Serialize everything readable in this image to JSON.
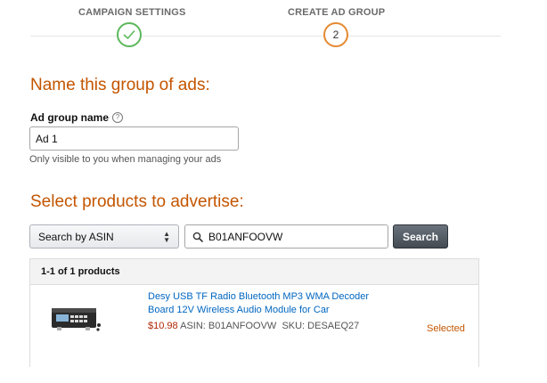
{
  "stepper": {
    "steps": [
      {
        "label": "CAMPAIGN SETTINGS",
        "state": "completed"
      },
      {
        "label": "CREATE AD GROUP",
        "number": "2",
        "state": "current"
      }
    ],
    "colors": {
      "completed": "#5cb85c",
      "current": "#e48a32"
    }
  },
  "ad_group": {
    "heading": "Name this group of ads:",
    "field_label": "Ad group name",
    "help_icon": "question-circle-icon",
    "value": "Ad 1",
    "hint": "Only visible to you when managing your ads"
  },
  "products": {
    "heading": "Select products to advertise:",
    "search_type": {
      "selected": "Search by ASIN"
    },
    "search": {
      "value": "B01ANFOOVW",
      "button_label": "Search",
      "icon": "search-icon"
    },
    "results": {
      "count_label": "1-1 of 1 products",
      "items": [
        {
          "title": "Desy USB TF Radio Bluetooth MP3 WMA Decoder Board 12V Wireless Audio Module for Car",
          "price": "$10.98",
          "asin": "ASIN: B01ANFOOVW",
          "sku": "SKU: DESAEQ27",
          "status": "Selected"
        }
      ]
    }
  },
  "colors": {
    "heading": "#c45500",
    "link": "#0066c0",
    "price": "#b12704"
  }
}
